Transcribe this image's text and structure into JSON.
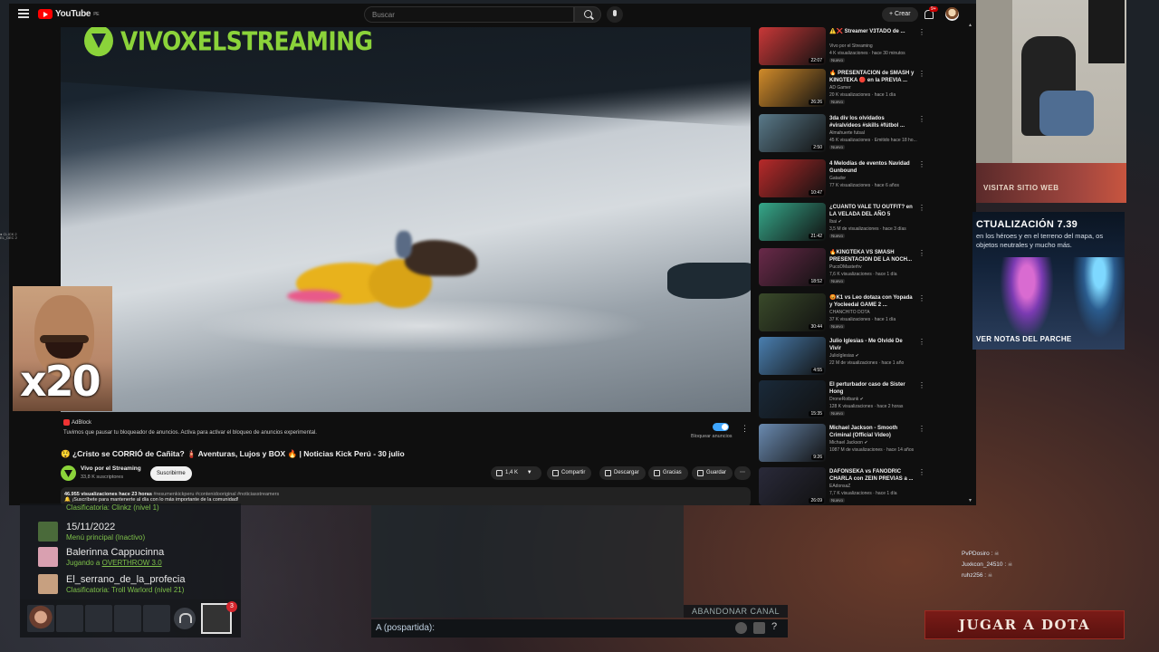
{
  "youtube": {
    "logo_text": "YouTube",
    "logo_sup": "PE",
    "search_placeholder": "Buscar",
    "create_label": "+ Crear",
    "notif_count": "9+",
    "video": {
      "overlay_channel": "VIVOXELSTREAMING"
    },
    "adblock": {
      "brand": "AdBlock",
      "message": "Tuvimos que pausar tu bloqueador de anuncios. Activa para activar el bloqueo de anuncios experimental.",
      "toggle_label": "Bloquear anuncios"
    },
    "title": "😲 ¿Cristo se CORRIÓ de Cañita? 🧯 Aventuras, Lujos y BOX 🔥 | Noticias Kick Perú - 30 julio",
    "channel": {
      "name": "Vivo por el Streaming",
      "subs": "33,8 K suscriptores",
      "subscribe": "Suscribirme"
    },
    "actions": {
      "likes": "1,4 K",
      "share": "Compartir",
      "download": "Descargar",
      "thanks": "Gracias",
      "save": "Guardar",
      "more": "⋯"
    },
    "description": {
      "views": "46.955 visualizaciones  hace 23 horas",
      "tags": "#resumenkickperu #contenidooriginal #noticiasstreamers",
      "line2": "🔔 ¡Suscríbete para mantenerte al día con lo más importante de la comunidad!"
    },
    "suggestions": [
      {
        "title": "⚠️❌ Streamer V3TADO de ...",
        "channel": "Vivo por el Streaming",
        "meta": "4 K visualizaciones · hace 30 minutos",
        "badge": "Nuevo",
        "duration": "22:07",
        "bg": "#c93838"
      },
      {
        "title": "🔥 PRESENTACIÓN de SMASH y KINGTEKA 🔴 en la PREVIA ...",
        "channel": "AD Gamer",
        "meta": "20 K visualizaciones · hace 1 día",
        "badge": "Nuevo",
        "duration": "26:26",
        "bg": "#d18b2a"
      },
      {
        "title": "3da div los olvidados #viralvideos #skills #fútbol ...",
        "channel": "Almahuerte futsal",
        "meta": "45 K visualizaciones · Emitido hace 18 ho...",
        "badge": "Nuevo",
        "duration": "2:50",
        "bg": "#5a7a8a"
      },
      {
        "title": "4 Melodías de eventos Navidad Gunbound",
        "channel": "Gatador",
        "meta": "77 K visualizaciones · hace 6 años",
        "badge": "",
        "duration": "10:47",
        "bg": "#b82a2a"
      },
      {
        "title": "¿CUÁNTO VALE TU OUTFIT? en LA VELADA DEL AÑO 5",
        "channel": "Ibai ✔",
        "meta": "3,5 M de visualizaciones · hace 3 días",
        "badge": "Nuevo",
        "duration": "21:42",
        "bg": "#36a88a"
      },
      {
        "title": "🔥KINGTEKA VS SMASH PRESENTACION DE LA NOCH...",
        "channel": "PucoDMasterhv",
        "meta": "7,6 K visualizaciones · hace 1 día",
        "badge": "Nuevo",
        "duration": "18:52",
        "bg": "#6a2a4a"
      },
      {
        "title": "😡K1 vs Leo dotaza con Yopada y Yocleedal GAME 2 ...",
        "channel": "CHANCHITO DOTA",
        "meta": "37 K visualizaciones · hace 1 día",
        "badge": "Nuevo",
        "duration": "30:44",
        "bg": "#3a4a2a"
      },
      {
        "title": "Julio Iglesias - Me Olvidé De Vivir",
        "channel": "JulioIglesias ✔",
        "meta": "22 M de visualizaciones · hace 1 año",
        "badge": "",
        "duration": "4:55",
        "bg": "#4a7fb0"
      },
      {
        "title": "El perturbador caso de Sister Hong",
        "channel": "DroneRotbank ✔",
        "meta": "128 K visualizaciones · hace 2 horas",
        "badge": "Nuevo",
        "duration": "15:35",
        "bg": "#1a2a3a"
      },
      {
        "title": "Michael Jackson - Smooth Criminal (Official Video)",
        "channel": "Michael Jackson ✔",
        "meta": "1087 M de visualizaciones · hace 14 años",
        "badge": "",
        "duration": "9:26",
        "bg": "#6a8ab0"
      },
      {
        "title": "DAFONSEKA vs FANODRIC CHARLA con ZEIN PREVIAS a ...",
        "channel": "EAdonsaZ",
        "meta": "7,7 K visualizaciones · hace 1 día",
        "badge": "Nuevo",
        "duration": "26:09",
        "bg": "#2a2a3a"
      }
    ]
  },
  "meme": {
    "text": "x20"
  },
  "dota": {
    "visit_site": "VISITAR SITIO WEB",
    "patch_title": "CTUALIZACIÓN 7.39",
    "patch_text": "en los héroes y en el terreno del mapa, os objetos neutrales y mucho más.",
    "patch_notes": "VER NOTAS DEL PARCHE",
    "friends": [
      {
        "name": "",
        "status": "Clasificatoria: Clinkz (nivel 1)",
        "link": "",
        "color": "#3d5a3a"
      },
      {
        "name": "15/11/2022",
        "status": "Menú principal (Inactivo)",
        "link": "",
        "color": "#4a6a3a"
      },
      {
        "name": "Balerinna Cappucinna",
        "status": "Jugando a ",
        "link": "OVERTHROW 3.0",
        "color": "#d9a0b0"
      },
      {
        "name": "El_serrano_de_la_profecia",
        "status": "Clasificatoria: Troll Warlord (nivel 21)",
        "link": "",
        "color": "#c7a080"
      }
    ],
    "party_badge": "3",
    "abandon": "ABANDONAR CANAL",
    "chat_label": "A (pospartida):",
    "chat_help": "?",
    "kill_feed": [
      "PvPDosiro :",
      "Juxkcon_24510 :",
      "ruhz256 :"
    ],
    "play_button": "JUGAR A DOTA"
  },
  "tiny_overlay": [
    "● CLICK 2",
    "EL_DEC 2"
  ]
}
